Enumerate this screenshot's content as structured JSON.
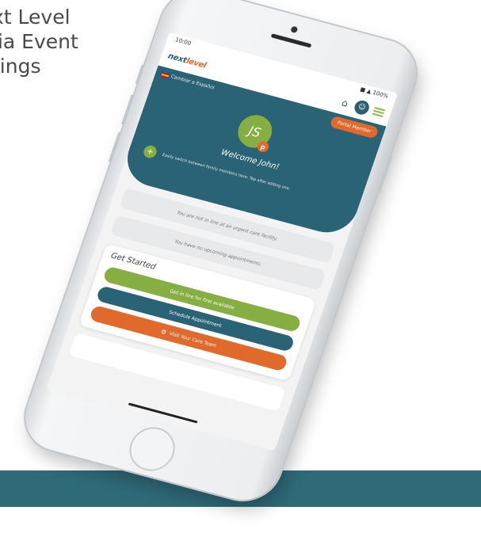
{
  "promo": {
    "line1": "xt Level",
    "line2": "lia Event",
    "line3": "tings"
  },
  "phone": {
    "status_time": "10:00",
    "status_right": "■ ▲ 100%",
    "logo_main": "next",
    "logo_accent": "level",
    "header_icons": [
      "home-icon",
      "chat-icon",
      "menu-icon"
    ],
    "language_label": "Cambiar a Español",
    "portal_button": "Portal Member",
    "avatar_initials": "JS",
    "avatar_badge": "p",
    "welcome": "Welcome John!",
    "switch_text": "Easily switch between family members here. Tap after adding one.",
    "info_cards": [
      "You are not in line at an urgent care facility.",
      "You have no upcoming appointments."
    ],
    "get_started_title": "Get Started",
    "actions": [
      {
        "label": "Get in line for first available",
        "color": "#86ae42"
      },
      {
        "label": "Schedule Appointment",
        "color": "#2a6276"
      },
      {
        "label": "Visit Your Care Team",
        "color": "#e06a2c"
      }
    ]
  },
  "colors": {
    "teal": "#2a6276",
    "green": "#86ae42",
    "orange": "#e06a2c",
    "band": "#2f6a78"
  }
}
